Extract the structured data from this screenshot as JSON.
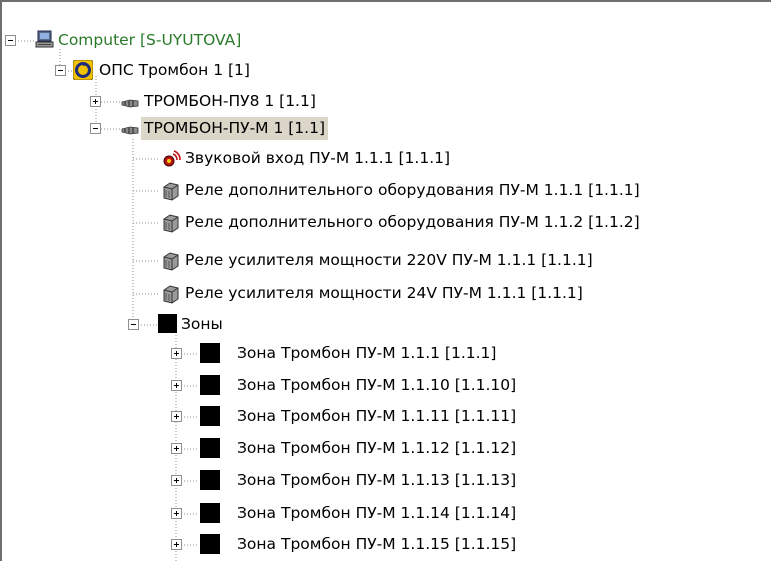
{
  "tree": {
    "root": {
      "label": "Computer [S-UYUTOVA]",
      "icon": "computer-icon",
      "expanded": true
    },
    "ops": {
      "label": "ОПС Тромбон 1 [1]",
      "icon": "ops-icon",
      "expanded": true
    },
    "pu8": {
      "label": "ТРОМБОН-ПУ8 1 [1.1]",
      "icon": "device-icon",
      "expanded": false
    },
    "pum": {
      "label": "ТРОМБОН-ПУ-М 1 [1.1]",
      "icon": "device-icon",
      "expanded": true,
      "selected": true
    },
    "children": [
      {
        "label": "Звуковой вход ПУ-М 1.1.1 [1.1.1]",
        "icon": "audio-input-icon"
      },
      {
        "label": "Реле дополнительного оборудования ПУ-М 1.1.1 [1.1.1]",
        "icon": "relay-icon"
      },
      {
        "label": "Реле дополнительного оборудования ПУ-М 1.1.2 [1.1.2]",
        "icon": "relay-icon"
      },
      {
        "label": "Реле усилителя мощности 220V ПУ-М 1.1.1 [1.1.1]",
        "icon": "relay-icon"
      },
      {
        "label": "Реле усилителя мощности 24V ПУ-М 1.1.1 [1.1.1]",
        "icon": "relay-icon"
      }
    ],
    "zones": {
      "label": "Зоны",
      "icon": "zone-folder-icon",
      "expanded": true
    },
    "zone_items": [
      {
        "label": "Зона Тромбон ПУ-М 1.1.1 [1.1.1]"
      },
      {
        "label": "Зона Тромбон ПУ-М 1.1.10 [1.1.10]"
      },
      {
        "label": "Зона Тромбон ПУ-М 1.1.11 [1.1.11]"
      },
      {
        "label": "Зона Тромбон ПУ-М 1.1.12 [1.1.12]"
      },
      {
        "label": "Зона Тромбон ПУ-М 1.1.13 [1.1.13]"
      },
      {
        "label": "Зона Тромбон ПУ-М 1.1.14 [1.1.14]"
      },
      {
        "label": "Зона Тромбон ПУ-М 1.1.15 [1.1.15]"
      }
    ]
  },
  "colors": {
    "root_text": "#2a7a2a",
    "selection": "#dcd6c8",
    "tree_lines": "#8f8f8f"
  }
}
